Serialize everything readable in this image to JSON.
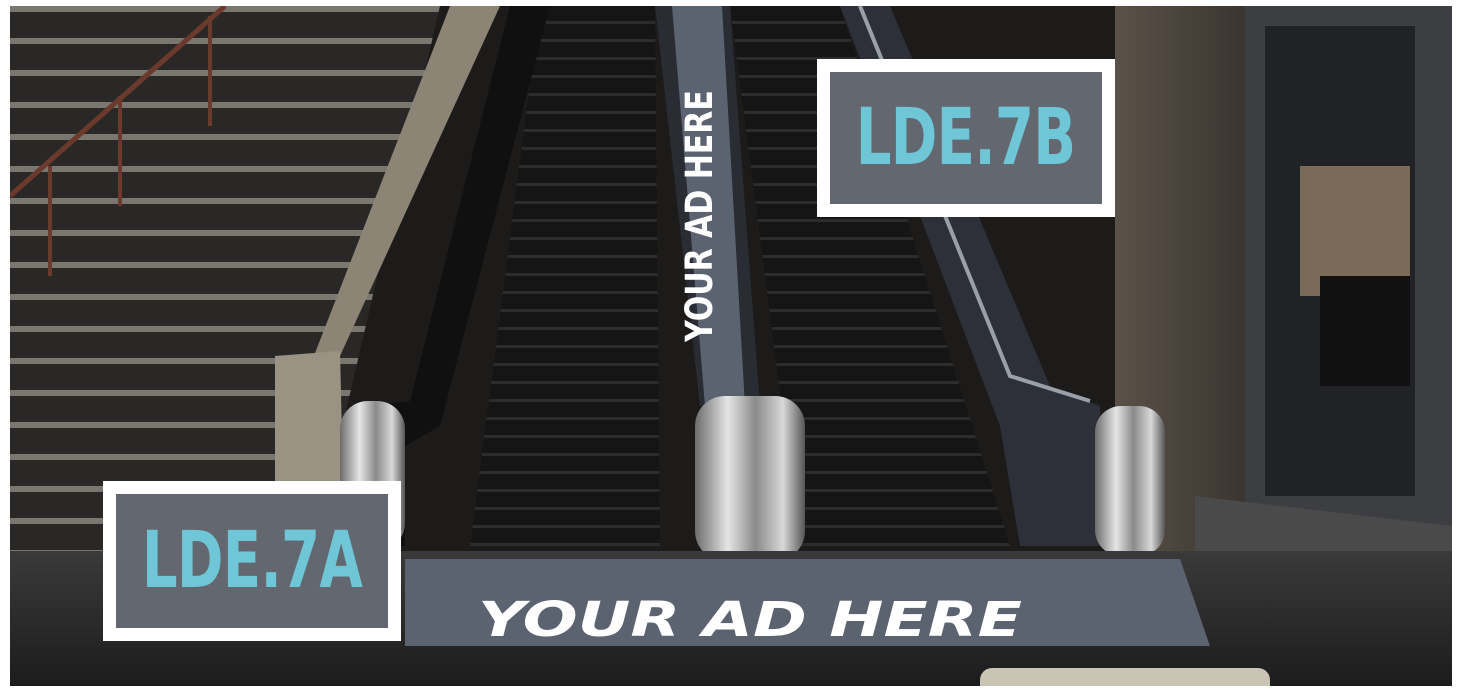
{
  "labels": {
    "placement_a": "LDE.7A",
    "placement_b": "LDE.7B"
  },
  "ads": {
    "floor_text": "YOUR AD HERE",
    "handrail_text": "YOUR AD HERE"
  },
  "colors": {
    "label_text": "#6fc6d6",
    "label_bg": "#636870",
    "label_border": "#ffffff",
    "ad_panel": "#5b6370"
  }
}
